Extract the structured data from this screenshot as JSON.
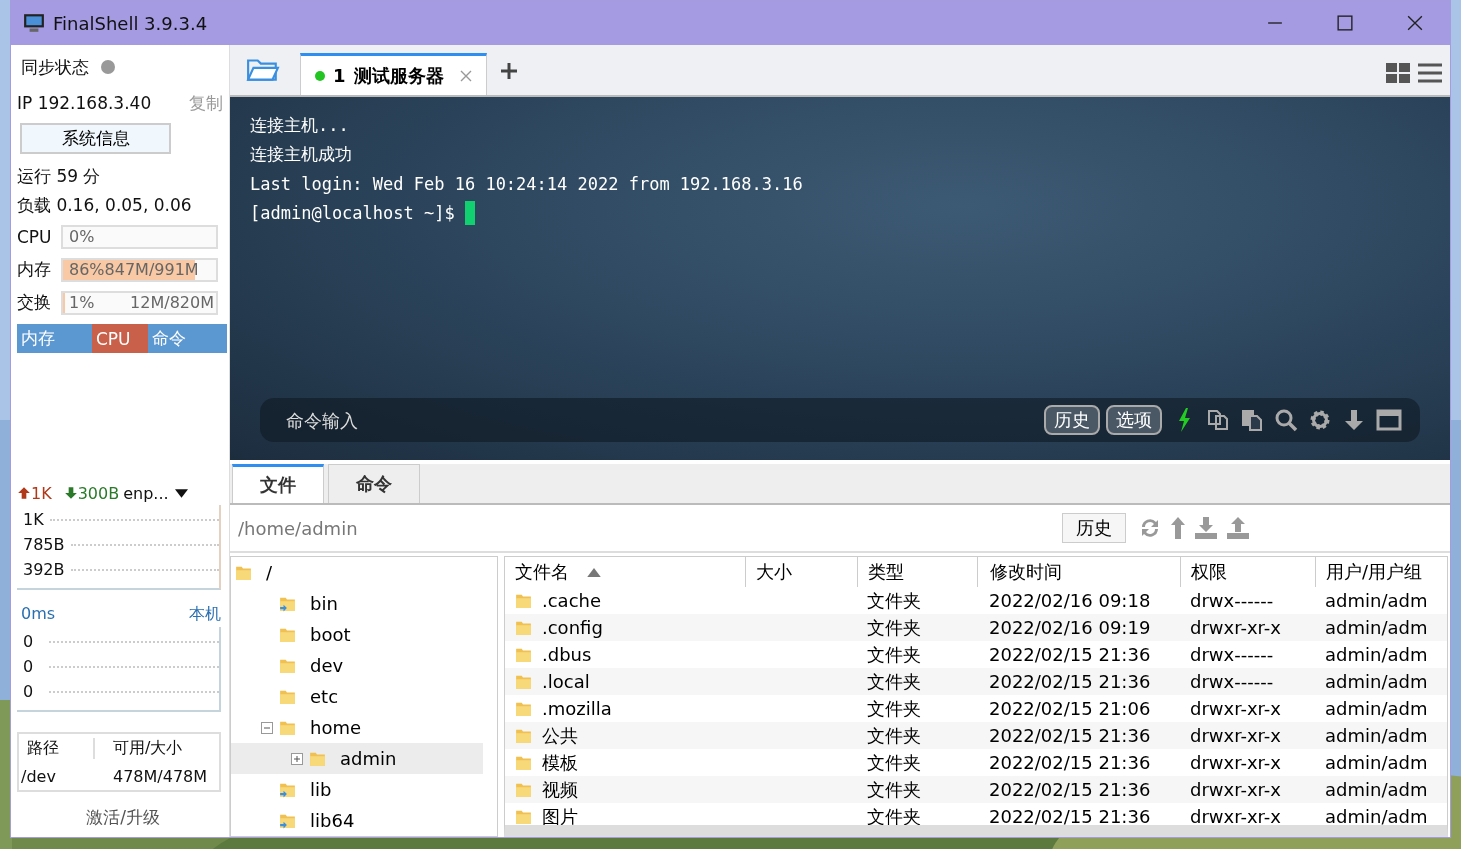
{
  "window": {
    "title": "FinalShell 3.9.3.4"
  },
  "sidebar": {
    "sync": {
      "label": "同步状态",
      "connected": false
    },
    "ip": {
      "text": "IP 192.168.3.40",
      "copy": "复制"
    },
    "sysinfo_button": "系统信息",
    "uptime": "运行 59 分",
    "load": "负载 0.16, 0.05, 0.06",
    "meters": [
      {
        "label": "CPU",
        "reading": "0%",
        "level": 0
      },
      {
        "label": "内存",
        "reading": "86%847M/991M",
        "level": 0.86
      },
      {
        "label": "交换",
        "reading": "1%",
        "detail": "12M/820M",
        "level": 0.01
      }
    ],
    "process_tabs": [
      {
        "label": "内存",
        "selected": false
      },
      {
        "label": "CPU",
        "selected": true
      },
      {
        "label": "命令",
        "selected": false
      }
    ],
    "network": {
      "up": "1K",
      "down": "300B",
      "interface": "enp...",
      "ticks": [
        "1K",
        "785B",
        "392B"
      ]
    },
    "ping": {
      "latency": "0ms",
      "target": "本机",
      "ticks": [
        "0",
        "0",
        "0"
      ]
    },
    "disks": {
      "columns": [
        "路径",
        "可用/大小"
      ],
      "rows": [
        [
          "/dev",
          "478M/478M"
        ]
      ]
    },
    "activate": "激活/升级"
  },
  "tabs": [
    {
      "number": "1",
      "label": "测试服务器",
      "selected": true,
      "connected": true
    }
  ],
  "terminal": {
    "lines": [
      "连接主机...",
      "连接主机成功",
      "Last login: Wed Feb 16 10:24:14 2022 from 192.168.3.16",
      "[admin@localhost ~]$"
    ],
    "command_input": {
      "placeholder": "命令输入"
    },
    "buttons": [
      "历史",
      "选项"
    ]
  },
  "file_panel": {
    "tabs": [
      {
        "label": "文件",
        "selected": true
      },
      {
        "label": "命令",
        "selected": false
      }
    ],
    "path": "/home/admin",
    "history_button": "历史",
    "tree": [
      {
        "name": "/",
        "link": false,
        "selected": false,
        "children": [
          {
            "name": "bin",
            "link": true,
            "selected": false
          },
          {
            "name": "boot",
            "link": false,
            "selected": false
          },
          {
            "name": "dev",
            "link": false,
            "selected": false
          },
          {
            "name": "etc",
            "link": false,
            "selected": false
          },
          {
            "name": "home",
            "link": false,
            "selected": false,
            "expanded": true,
            "children": [
              {
                "name": "admin",
                "link": false,
                "selected": true,
                "expanded": false
              }
            ]
          },
          {
            "name": "lib",
            "link": true,
            "selected": false
          },
          {
            "name": "lib64",
            "link": true,
            "selected": false
          }
        ]
      }
    ],
    "table": {
      "columns": [
        {
          "label": "文件名",
          "sort_ascending": true
        },
        {
          "label": "大小"
        },
        {
          "label": "类型"
        },
        {
          "label": "修改时间"
        },
        {
          "label": "权限"
        },
        {
          "label": "用户/用户组"
        }
      ],
      "rows": [
        [
          ".cache",
          "",
          "文件夹",
          "2022/02/16 09:18",
          "drwx------",
          "admin/adm"
        ],
        [
          ".config",
          "",
          "文件夹",
          "2022/02/16 09:19",
          "drwxr-xr-x",
          "admin/adm"
        ],
        [
          ".dbus",
          "",
          "文件夹",
          "2022/02/15 21:36",
          "drwx------",
          "admin/adm"
        ],
        [
          ".local",
          "",
          "文件夹",
          "2022/02/15 21:36",
          "drwx------",
          "admin/adm"
        ],
        [
          ".mozilla",
          "",
          "文件夹",
          "2022/02/15 21:06",
          "drwxr-xr-x",
          "admin/adm"
        ],
        [
          "公共",
          "",
          "文件夹",
          "2022/02/15 21:36",
          "drwxr-xr-x",
          "admin/adm"
        ],
        [
          "模板",
          "",
          "文件夹",
          "2022/02/15 21:36",
          "drwxr-xr-x",
          "admin/adm"
        ],
        [
          "视频",
          "",
          "文件夹",
          "2022/02/15 21:36",
          "drwxr-xr-x",
          "admin/adm"
        ],
        [
          "图片",
          "",
          "文件夹",
          "2022/02/15 21:36",
          "drwxr-xr-x",
          "admin/adm"
        ]
      ]
    }
  }
}
